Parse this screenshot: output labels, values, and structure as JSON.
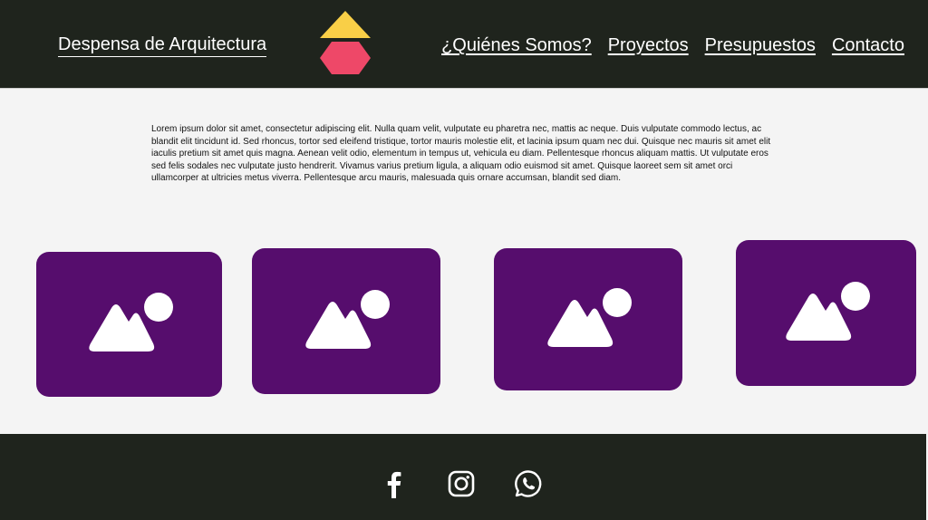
{
  "header": {
    "brand": "Despensa de Arquitectura",
    "nav": [
      "¿Quiénes Somos?",
      "Proyectos",
      "Presupuestos",
      "Contacto"
    ]
  },
  "main": {
    "intro": "Lorem ipsum dolor sit amet, consectetur adipiscing elit. Nulla quam velit, vulputate eu pharetra nec, mattis ac neque. Duis vulputate commodo lectus, ac blandit elit tincidunt id. Sed rhoncus, tortor sed eleifend tristique, tortor mauris molestie elit, et lacinia ipsum quam nec dui. Quisque nec mauris sit amet elit iaculis pretium sit amet quis magna. Aenean velit odio, elementum in tempus ut, vehicula eu diam. Pellentesque rhoncus aliquam mattis. Ut vulputate eros sed felis sodales nec vulputate justo hendrerit. Vivamus varius pretium ligula, a aliquam odio euismod sit amet. Quisque laoreet sem sit amet orci ullamcorper at ultricies metus viverra. Pellentesque arcu mauris, malesuada quis ornare accumsan, blandit sed diam.",
    "gallery_icon": "image-placeholder-icon"
  },
  "footer": {
    "social_icons": [
      "facebook-icon",
      "instagram-icon",
      "whatsapp-icon"
    ]
  },
  "colors": {
    "header_bg": "#1f241d",
    "content_bg": "#f4f4f4",
    "card_bg": "#560d6d",
    "logo_triangle": "#f9cf47",
    "logo_hexagon": "#ee4868"
  }
}
